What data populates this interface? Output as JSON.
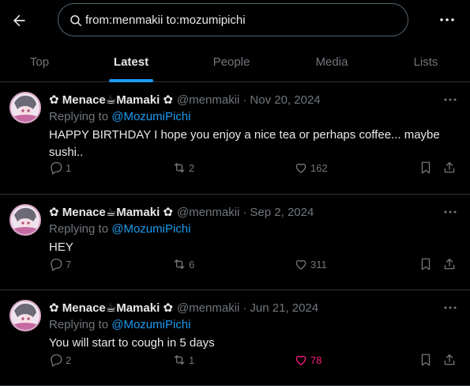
{
  "search": {
    "query": "from:menmakii to:mozumipichi"
  },
  "tabs": [
    {
      "label": "Top"
    },
    {
      "label": "Latest"
    },
    {
      "label": "People"
    },
    {
      "label": "Media"
    },
    {
      "label": "Lists"
    }
  ],
  "active_tab": "Latest",
  "colors": {
    "accent": "#1d9bf0",
    "like_active": "#f91880",
    "background": "#000000",
    "muted": "#71767b",
    "border": "#2f3336"
  },
  "icons": [
    "back-arrow-icon",
    "search-icon",
    "more-icon",
    "reply-icon",
    "retweet-icon",
    "like-icon",
    "bookmark-icon",
    "share-icon"
  ],
  "tweets": [
    {
      "display_name": "✿ Menace☕Mamaki ✿",
      "handle": "@menmakii",
      "separator": "·",
      "date": "Nov 20, 2024",
      "replying_prefix": "Replying to ",
      "replying_to": "@MozumiPichi",
      "text": "HAPPY BIRTHDAY I hope you enjoy a nice tea or perhaps coffee... maybe sushi..",
      "replies": "1",
      "reposts": "2",
      "likes": "162",
      "liked": false
    },
    {
      "display_name": "✿ Menace☕Mamaki ✿",
      "handle": "@menmakii",
      "separator": "·",
      "date": "Sep 2, 2024",
      "replying_prefix": "Replying to ",
      "replying_to": "@MozumiPichi",
      "text": "HEY",
      "replies": "7",
      "reposts": "6",
      "likes": "311",
      "liked": false
    },
    {
      "display_name": "✿ Menace☕Mamaki ✿",
      "handle": "@menmakii",
      "separator": "·",
      "date": "Jun 21, 2024",
      "replying_prefix": "Replying to ",
      "replying_to": "@MozumiPichi",
      "text": "You will start to cough in 5 days",
      "replies": "2",
      "reposts": "1",
      "likes": "78",
      "liked": true
    }
  ]
}
